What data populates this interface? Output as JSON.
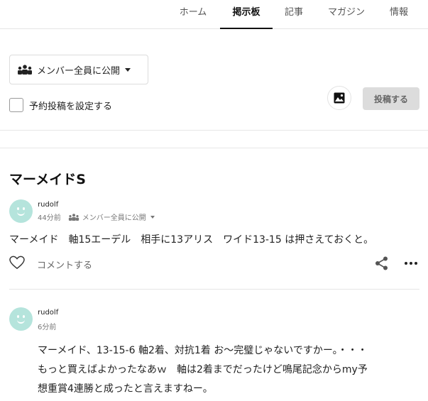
{
  "tabs": [
    {
      "label": "ホーム",
      "active": false
    },
    {
      "label": "掲示板",
      "active": true
    },
    {
      "label": "記事",
      "active": false
    },
    {
      "label": "マガジン",
      "active": false
    },
    {
      "label": "情報",
      "active": false
    }
  ],
  "composer": {
    "visibility_label": "メンバー全員に公開",
    "schedule_label": "予約投稿を設定する",
    "submit_label": "投稿する"
  },
  "board": {
    "title": "マーメイドS"
  },
  "posts": [
    {
      "username": "rudolf",
      "time": "44分前",
      "visibility": "メンバー全員に公開",
      "body": "マーメイド　軸15エーデル　相手に13アリス　ワイド13-15 は押さえておくと。",
      "comment_label": "コメントする"
    },
    {
      "username": "rudolf",
      "time": "6分前",
      "body_lines": [
        "マーメイド、13-15-6 軸2着、対抗1着 お～完璧じゃないですかー。・・・",
        "もっと買えばよかったなあｗ　軸は2着までだったけど鳴尾記念からmy予",
        "想重賞4連勝と成ったと言えますねー。"
      ]
    }
  ],
  "colors": {
    "avatar": "#b5e4dc",
    "submit_bg": "#dcdcdc",
    "divider": "#e6e6e6"
  },
  "icons": [
    "members-icon",
    "caret-down-icon",
    "image-icon",
    "heart-icon",
    "share-icon",
    "more-icon"
  ]
}
